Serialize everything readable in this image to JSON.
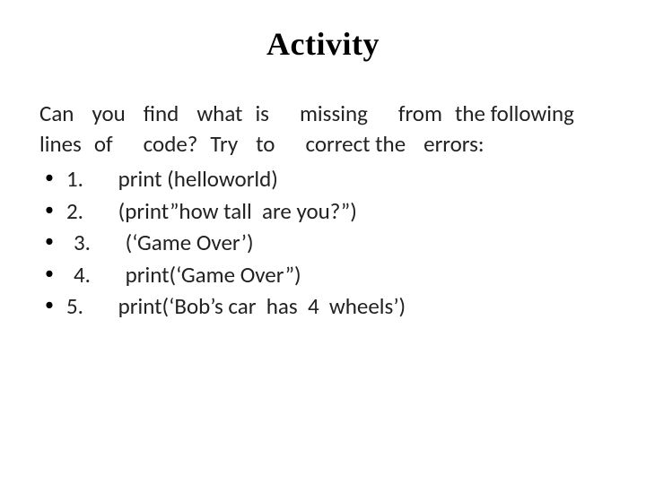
{
  "title": "Activity",
  "intro_html": "Can<span class='sp2'></span>you<span class='sp2'></span>find<span class='sp2'></span>what<span class='sp1'></span>is<span class='sp3'></span>missing<span class='sp3'></span>from<span class='sp1'></span>the following<span class='sp2'></span>lines<span class='sp1'></span>of<span class='sp3'></span>code?<span class='sp1'></span>Try<span class='sp2'></span>to<span class='sp3'></span>correct the<span class='sp2'></span>errors:",
  "items": [
    {
      "num": "1.",
      "pad": false,
      "code": "print (helloworld)"
    },
    {
      "num": "2.",
      "pad": false,
      "code": "(print”how tall  are you?”)"
    },
    {
      "num": "3.",
      "pad": true,
      "code": "(‘Game Over’)"
    },
    {
      "num": "4.",
      "pad": true,
      "code": "print(‘Game Over”)"
    },
    {
      "num": "5.",
      "pad": false,
      "code": "print(‘Bob’s car  has  4  wheels’)"
    }
  ]
}
